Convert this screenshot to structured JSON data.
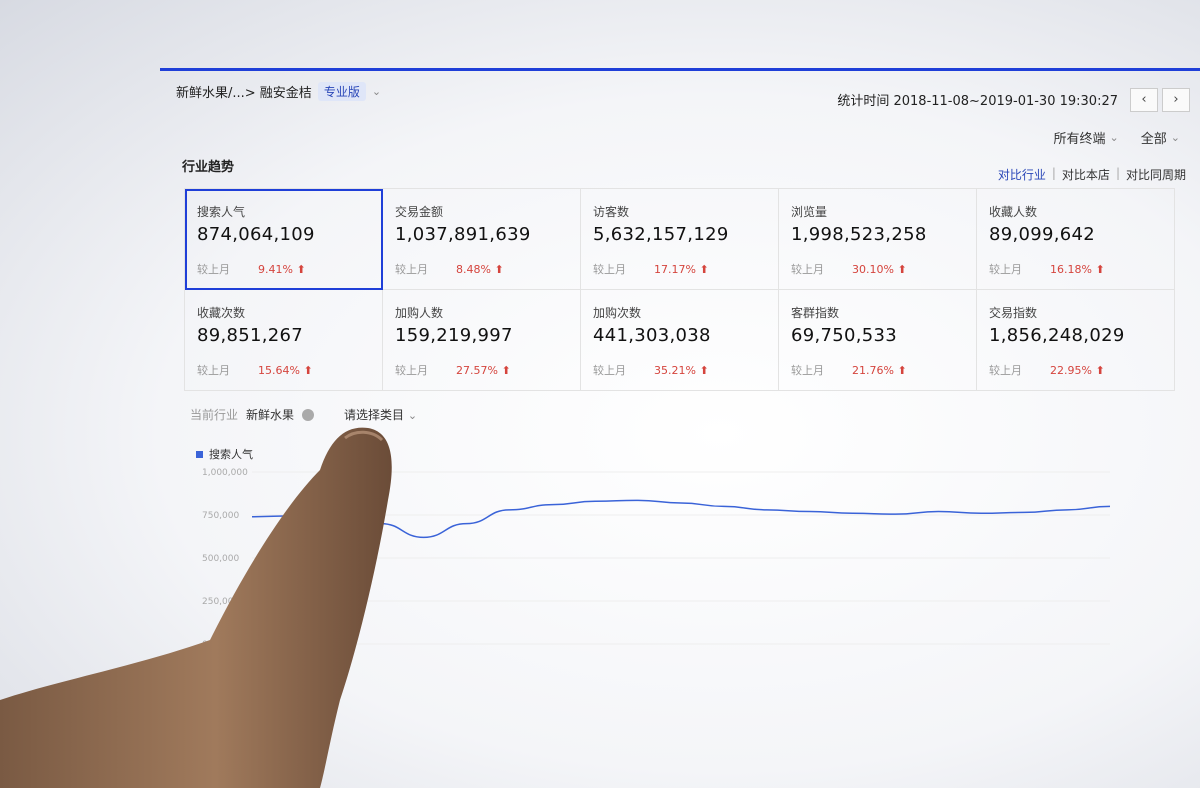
{
  "header": {
    "breadcrumb": "新鲜水果/...> 融安金桔",
    "edition_badge": "专业版",
    "stat_time_label": "统计时间",
    "stat_time_value": "2018-11-08~2019-01-30 19:30:27",
    "prev_label": "‹",
    "next_label": "›"
  },
  "filters": {
    "terminal": "所有终端",
    "scope": "全部"
  },
  "section": {
    "title": "行业趋势",
    "compare_options": [
      "对比行业",
      "对比本店",
      "对比同周期"
    ]
  },
  "metrics": [
    {
      "name": "搜索人气",
      "value": "874,064,109",
      "cmp_label": "较上月",
      "pct": "9.41%"
    },
    {
      "name": "交易金额",
      "value": "1,037,891,639",
      "cmp_label": "较上月",
      "pct": "8.48%"
    },
    {
      "name": "访客数",
      "value": "5,632,157,129",
      "cmp_label": "较上月",
      "pct": "17.17%"
    },
    {
      "name": "浏览量",
      "value": "1,998,523,258",
      "cmp_label": "较上月",
      "pct": "30.10%"
    },
    {
      "name": "收藏人数",
      "value": "89,099,642",
      "cmp_label": "较上月",
      "pct": "16.18%"
    },
    {
      "name": "收藏次数",
      "value": "89,851,267",
      "cmp_label": "较上月",
      "pct": "15.64%"
    },
    {
      "name": "加购人数",
      "value": "159,219,997",
      "cmp_label": "较上月",
      "pct": "27.57%"
    },
    {
      "name": "加购次数",
      "value": "441,303,038",
      "cmp_label": "较上月",
      "pct": "35.21%"
    },
    {
      "name": "客群指数",
      "value": "69,750,533",
      "cmp_label": "较上月",
      "pct": "21.76%"
    },
    {
      "name": "交易指数",
      "value": "1,856,248,029",
      "cmp_label": "较上月",
      "pct": "22.95%"
    }
  ],
  "industry": {
    "label": "当前行业",
    "value": "新鲜水果",
    "select_placeholder": "请选择类目"
  },
  "colors": {
    "accent": "#1f3fd8",
    "up": "#d5443d",
    "line": "#3a63d8"
  },
  "chart_data": {
    "type": "line",
    "series": [
      {
        "name": "搜索人气",
        "values": [
          740000,
          745000,
          760000,
          700000,
          620000,
          700000,
          780000,
          810000,
          830000,
          835000,
          820000,
          800000,
          780000,
          770000,
          760000,
          755000,
          770000,
          760000,
          765000,
          780000,
          800000
        ]
      }
    ],
    "yticks": [
      "1,000,000",
      "750,000",
      "500,000",
      "250,000",
      "0"
    ],
    "ylim": [
      0,
      1000000
    ]
  }
}
